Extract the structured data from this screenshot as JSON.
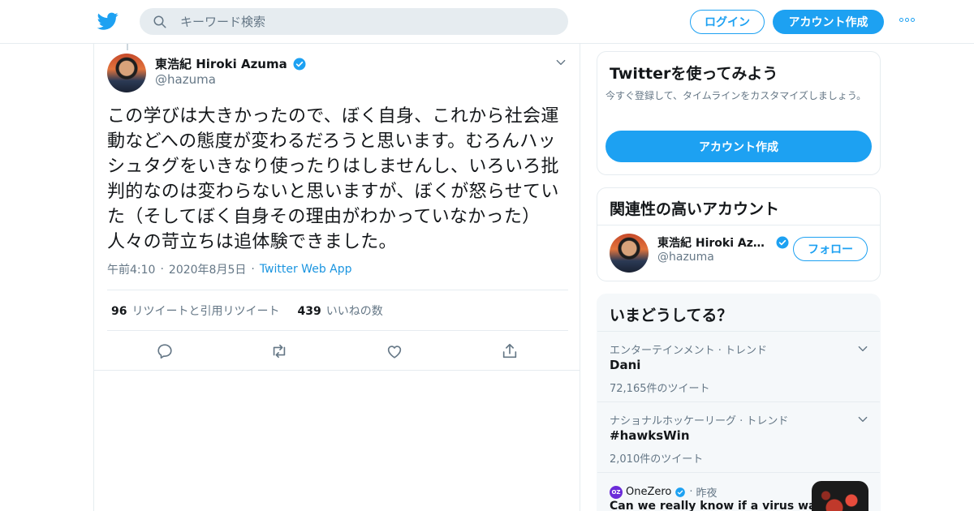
{
  "header": {
    "search_placeholder": "キーワード検索",
    "login_label": "ログイン",
    "signup_label": "アカウント作成"
  },
  "tweet": {
    "author_name": "東浩紀 Hiroki Azuma",
    "author_handle": "@hazuma",
    "text": "この学びは大きかったので、ぼく自身、これから社会運動などへの態度が変わるだろうと思います。むろんハッシュタグをいきなり使ったりはしませんし、いろいろ批判的なのは変わらないと思いますが、ぼくが怒らせていた（そしてぼく自身その理由がわかっていなかった）人々の苛立ちは追体験できました。",
    "time": "午前4:10",
    "date": "2020年8月5日",
    "app": "Twitter Web App",
    "retweet_count": "96",
    "retweet_label": "リツイートと引用リツイート",
    "like_count": "439",
    "like_label": "いいねの数"
  },
  "sidebar": {
    "signup_card": {
      "title": "Twitterを使ってみよう",
      "subtitle": "今すぐ登録して、タイムラインをカスタマイズしましょう。",
      "button_label": "アカウント作成"
    },
    "related_card": {
      "title": "関連性の高いアカウント",
      "account_name": "東浩紀 Hiroki Azuma",
      "account_handle": "@hazuma",
      "follow_label": "フォロー"
    },
    "trends_card": {
      "title": "いまどうしてる？",
      "trends": [
        {
          "context": "エンターテインメント · トレンド",
          "name": "Dani",
          "count": "72,165件のツイート"
        },
        {
          "context": "ナショナルホッケーリーグ · トレンド",
          "name": "#hawksWin",
          "count": "2,010件のツイート"
        }
      ],
      "news": {
        "source": "OneZero",
        "badge": "OZ",
        "time": "昨夜",
        "headline": "Can we really know if a virus was"
      }
    }
  },
  "colors": {
    "brand": "#1da1f2",
    "text": "#14171a",
    "secondary": "#657786",
    "border": "#e6ecf0"
  }
}
